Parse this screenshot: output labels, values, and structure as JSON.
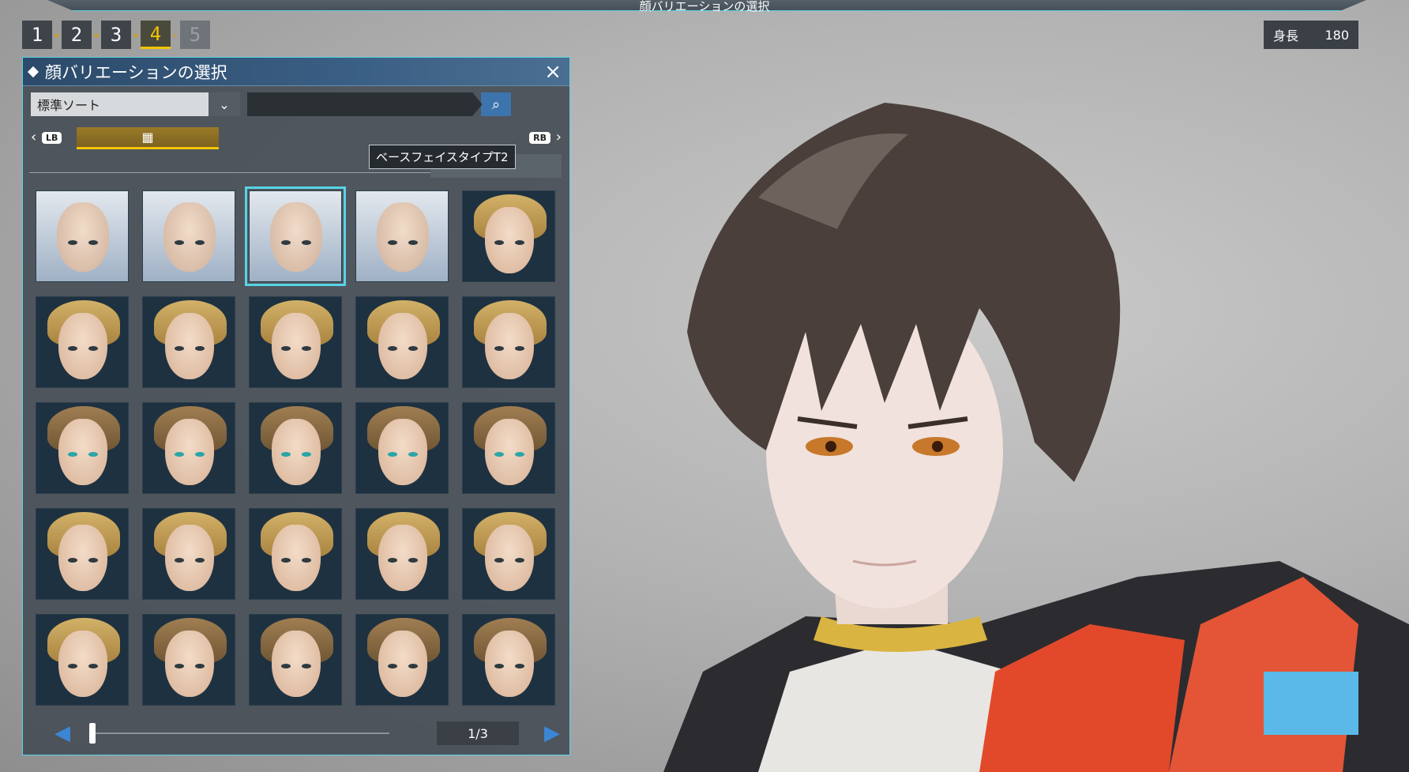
{
  "window_title": "顔バリエーションの選択",
  "steps": [
    {
      "label": "1",
      "state": "done"
    },
    {
      "label": "2",
      "state": "done"
    },
    {
      "label": "3",
      "state": "done"
    },
    {
      "label": "4",
      "state": "active"
    },
    {
      "label": "5",
      "state": "disabled"
    }
  ],
  "height": {
    "label": "身長",
    "value": "180"
  },
  "panel": {
    "title": "顔バリエーションの選択",
    "close_icon": "×",
    "sort": {
      "value": "標準ソート",
      "arrow": "⌄"
    },
    "search": {
      "placeholder": "",
      "icon": "⌕"
    },
    "tabs": {
      "left_button": "LB",
      "right_button": "RB",
      "left_chevron": "‹",
      "right_chevron": "›",
      "active_icon": "grid-icon",
      "active_glyph": "▦"
    },
    "tooltip": "ベースフェイスタイプT2",
    "faces": [
      {
        "type": "base",
        "hair": "none",
        "eyes": "dark",
        "selected": false
      },
      {
        "type": "base",
        "hair": "none",
        "eyes": "dark",
        "selected": false
      },
      {
        "type": "base",
        "hair": "none",
        "eyes": "dark",
        "selected": true
      },
      {
        "type": "base",
        "hair": "none",
        "eyes": "dark",
        "selected": false
      },
      {
        "type": "variant",
        "hair": "blond",
        "eyes": "dark",
        "selected": false
      },
      {
        "type": "variant",
        "hair": "blond",
        "eyes": "dark",
        "selected": false
      },
      {
        "type": "variant",
        "hair": "blond",
        "eyes": "dark",
        "selected": false
      },
      {
        "type": "variant",
        "hair": "blond",
        "eyes": "dark",
        "selected": false
      },
      {
        "type": "variant",
        "hair": "blond",
        "eyes": "dark",
        "selected": false
      },
      {
        "type": "variant",
        "hair": "blond",
        "eyes": "dark",
        "selected": false
      },
      {
        "type": "variant",
        "hair": "brown",
        "eyes": "teal",
        "selected": false
      },
      {
        "type": "variant",
        "hair": "brown",
        "eyes": "teal",
        "selected": false
      },
      {
        "type": "variant",
        "hair": "brown",
        "eyes": "teal",
        "selected": false
      },
      {
        "type": "variant",
        "hair": "brown",
        "eyes": "teal",
        "selected": false
      },
      {
        "type": "variant",
        "hair": "brown",
        "eyes": "teal",
        "selected": false
      },
      {
        "type": "variant",
        "hair": "blond",
        "eyes": "dark",
        "selected": false
      },
      {
        "type": "variant",
        "hair": "blond",
        "eyes": "dark",
        "selected": false
      },
      {
        "type": "variant",
        "hair": "blond",
        "eyes": "dark",
        "selected": false
      },
      {
        "type": "variant",
        "hair": "blond",
        "eyes": "dark",
        "selected": false
      },
      {
        "type": "variant",
        "hair": "blond",
        "eyes": "dark",
        "selected": false
      },
      {
        "type": "variant",
        "hair": "blond",
        "eyes": "dark",
        "selected": false
      },
      {
        "type": "variant",
        "hair": "brown",
        "eyes": "dark",
        "selected": false
      },
      {
        "type": "variant",
        "hair": "brown",
        "eyes": "dark",
        "selected": false
      },
      {
        "type": "variant",
        "hair": "brown",
        "eyes": "dark",
        "selected": false
      },
      {
        "type": "variant",
        "hair": "brown",
        "eyes": "dark",
        "selected": false
      }
    ],
    "pager": {
      "prev_glyph": "◀",
      "next_glyph": "▶",
      "page_text": "1/3",
      "position": 0.0
    }
  },
  "colors": {
    "accent": "#58d3e6",
    "active_step": "#f2c400",
    "search_button": "#3d74ad",
    "pager_arrows": "#3d86d6"
  }
}
